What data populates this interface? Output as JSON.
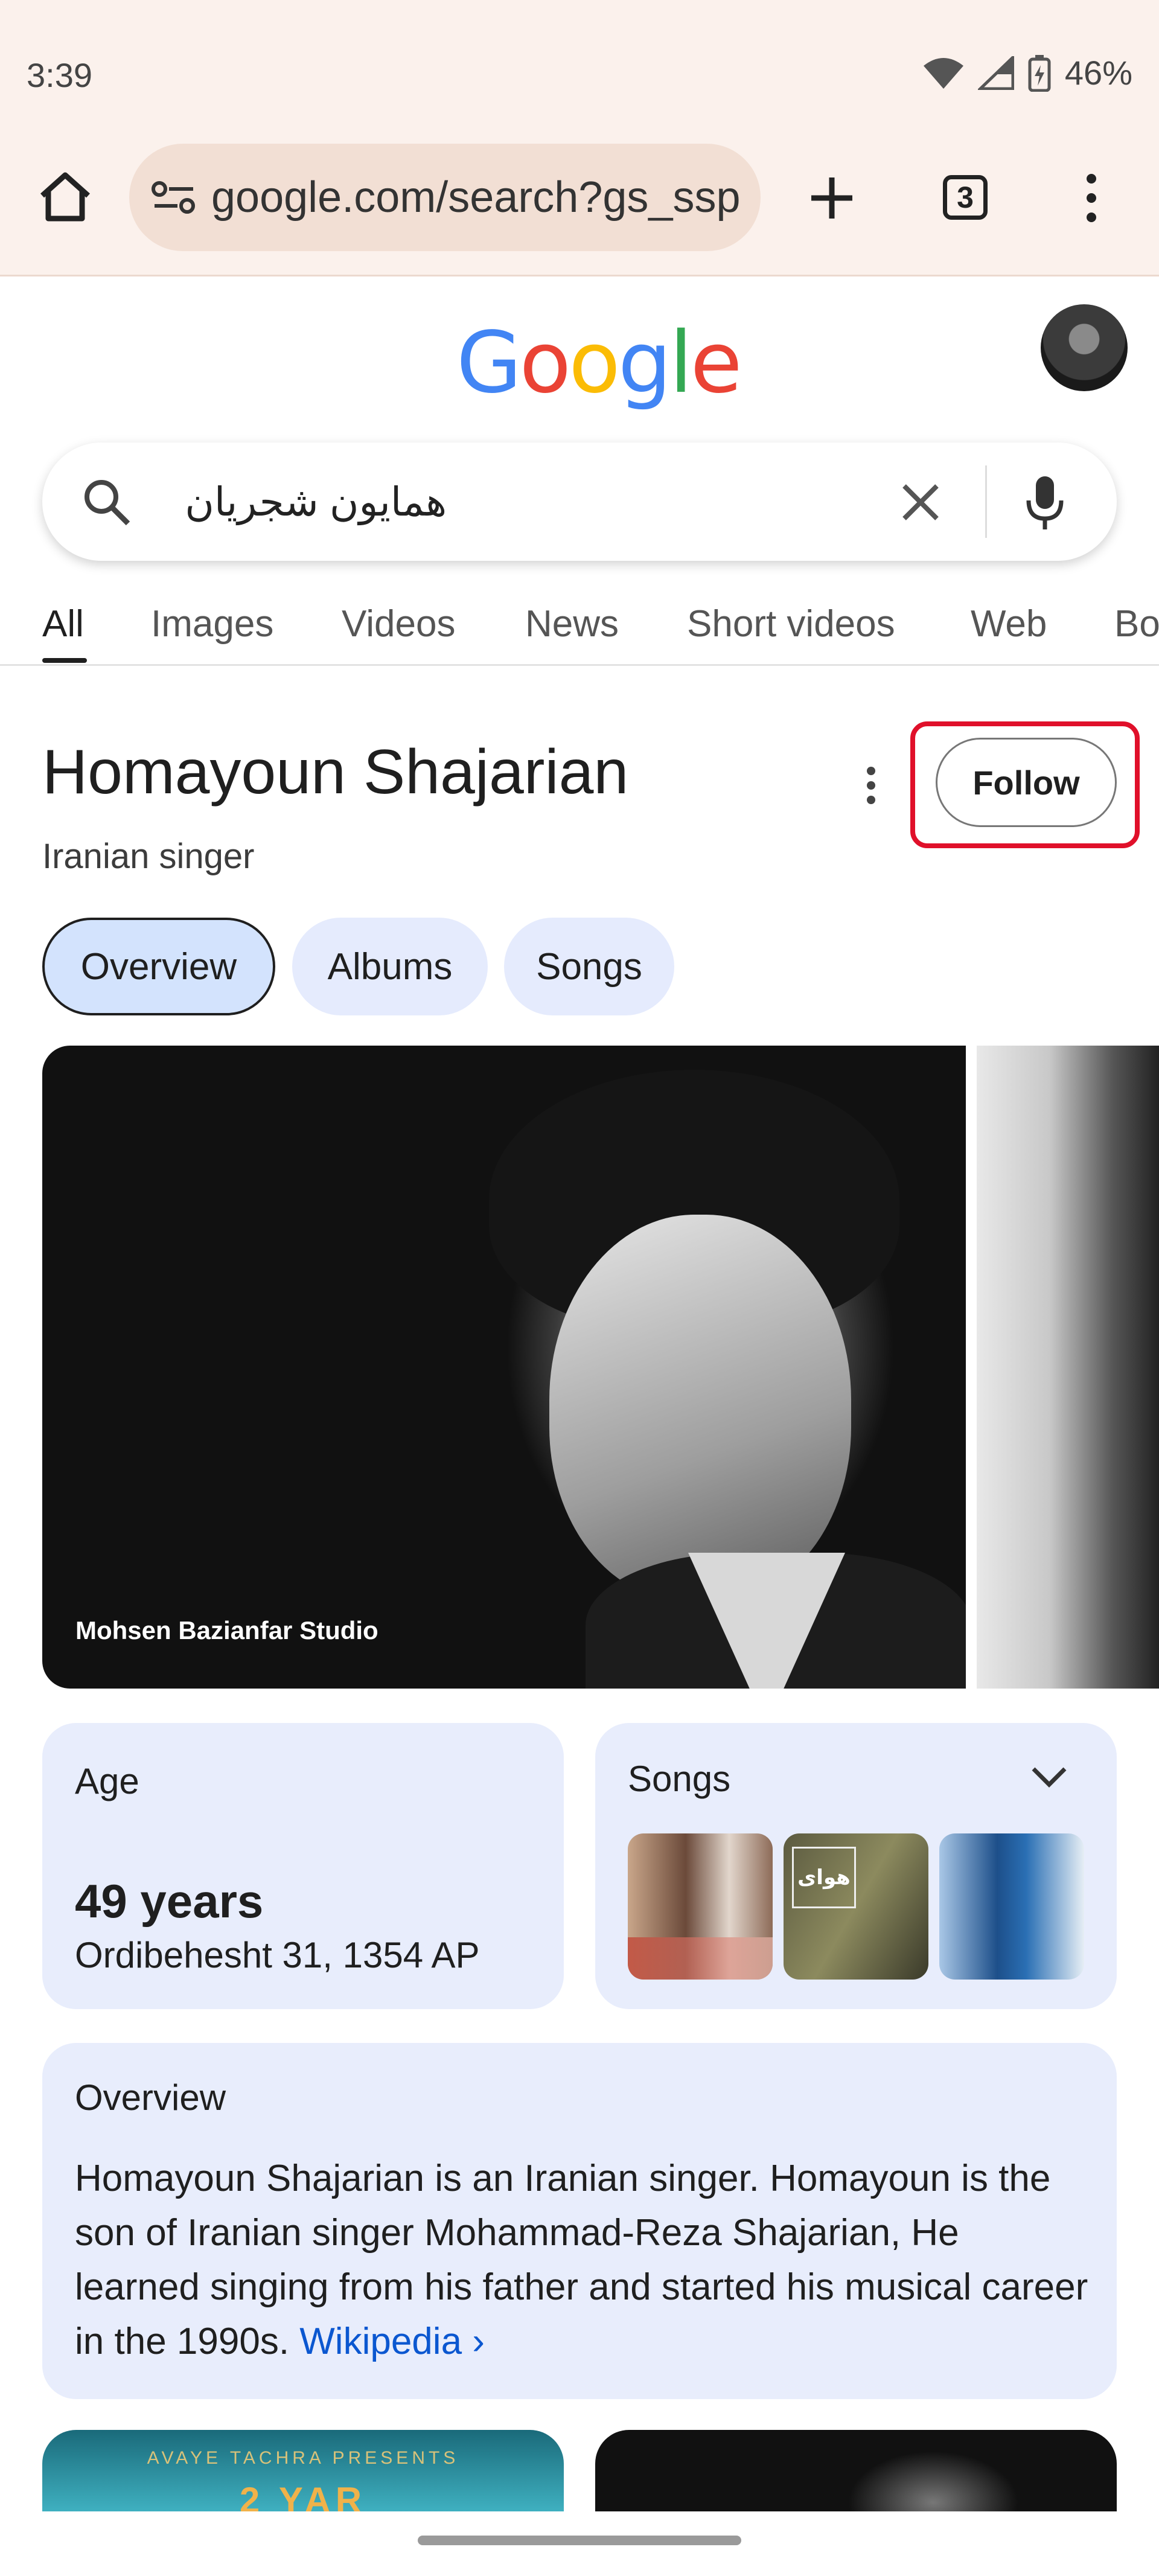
{
  "status_bar": {
    "time": "3:39",
    "battery": "46%"
  },
  "browser": {
    "url": "google.com/search?gs_ssp",
    "tab_count": "3"
  },
  "google": {
    "logo": "Google"
  },
  "search": {
    "query": "همایون شجریان"
  },
  "tabs": [
    "All",
    "Images",
    "Videos",
    "News",
    "Short videos",
    "Web",
    "Bo"
  ],
  "knowledge_panel": {
    "title": "Homayoun Shajarian",
    "subtitle": "Iranian singer",
    "follow_label": "Follow",
    "chips": [
      "Overview",
      "Albums",
      "Songs"
    ],
    "photo_caption": "Mohsen Bazianfar Studio"
  },
  "age_card": {
    "label": "Age",
    "value": "49 years",
    "date": "Ordibehesht 31, 1354 AP"
  },
  "songs_card": {
    "label": "Songs",
    "thumb_2_text": "هوای"
  },
  "overview_card": {
    "label": "Overview",
    "text": "Homayoun Shajarian is an Iranian singer. Homayoun is the son of Iranian singer Mohammad-Reza Shajarian, He learned singing from his father and started his musical career in the 1990s.",
    "link": "Wikipedia",
    "link_arrow": "›"
  },
  "bottom_cards": {
    "left_text_1": "AVAYE TACHRA PRESENTS",
    "left_text_2": "2 YAR"
  },
  "colors": {
    "chrome_bg": "#fbf1ec",
    "card_bg": "#e8edfc",
    "highlight": "#e0102a",
    "link": "#0b57d0"
  }
}
